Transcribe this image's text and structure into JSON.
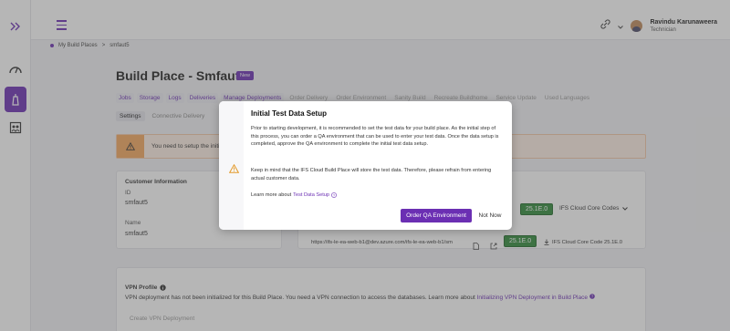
{
  "header": {
    "user_name": "Ravindu Karunaweera",
    "user_role": "Technician"
  },
  "breadcrumb": {
    "item1": "My Build Places",
    "separator": ">",
    "item2": "smfaut5"
  },
  "page": {
    "title": "Build Place - Smfaut5",
    "badge": "New"
  },
  "tabs": [
    {
      "label": "Jobs"
    },
    {
      "label": "Storage"
    },
    {
      "label": "Logs"
    },
    {
      "label": "Deliveries"
    },
    {
      "label": "Manage Deployments"
    },
    {
      "label": "Order Delivery"
    },
    {
      "label": "Order Environment"
    },
    {
      "label": "Sanity Build"
    },
    {
      "label": "Recreate Buildhome"
    },
    {
      "label": "Service Update"
    },
    {
      "label": "Used Languages"
    }
  ],
  "subtabs": [
    {
      "label": "Settings"
    },
    {
      "label": "Connective Delivery"
    }
  ],
  "banner": {
    "text": "You need to setup the initial"
  },
  "customer_card": {
    "heading": "Customer Information",
    "id_label": "ID",
    "id_value": "smfaut5",
    "name_label": "Name",
    "name_value": "smfaut5"
  },
  "env_card": {
    "url": "https://ifs-le-ea-web-b1@dev.azure.com/ifs-le-ea-web-b1/sm",
    "version_chip_1": "25.1E.0",
    "version_select": "IFS Cloud Core Codes",
    "version_chip_2": "25.1E.0",
    "download_label": "IFS Cloud Core Code 25.1E.0"
  },
  "vpn_card": {
    "heading": "VPN Profile",
    "text": "VPN deployment has not been initialized for this Build Place. You need a VPN connection to access the databases. Learn more about",
    "link": "Initializing VPN Deployment in Build Place",
    "create_button": "Create VPN Deployment"
  },
  "modal": {
    "title": "Initial Test Data Setup",
    "para1": "Prior to starting development, it is recommended to set the test data for your build place. As the initial step of this process, you can order a QA environment that can be used to enter your test data. Once the data setup is completed, approve the QA environment to complete the initial test data setup.",
    "para2": "Keep in mind that the IFS Cloud Build Place will store the test data. Therefore, please refrain from entering actual customer data.",
    "learn_prefix": "Learn more about",
    "learn_link": "Test Data Setup",
    "primary_button": "Order QA Environment",
    "secondary_button": "Not Now"
  }
}
